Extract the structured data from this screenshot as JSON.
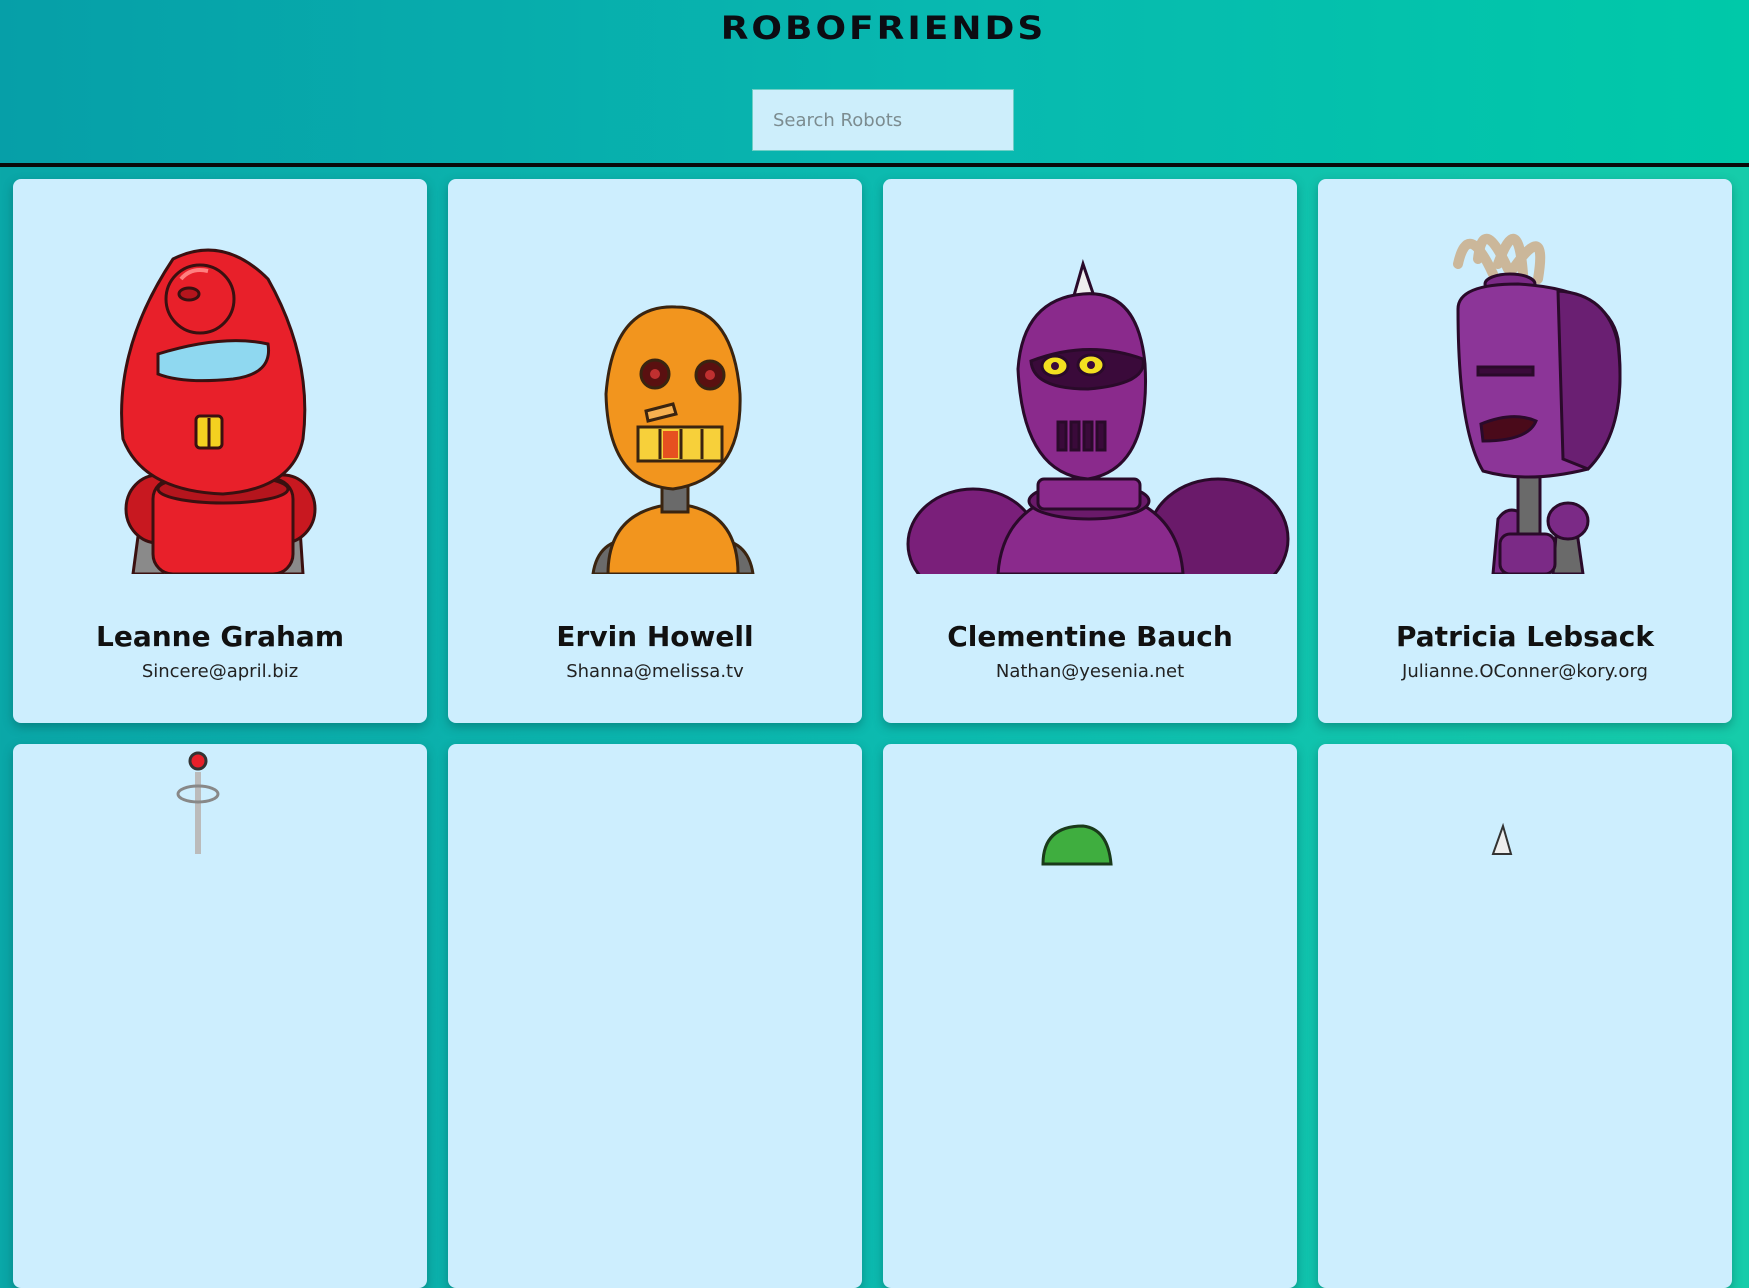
{
  "header": {
    "title": "ROBOFRIENDS",
    "search_placeholder": "Search Robots"
  },
  "robots": [
    {
      "name": "Leanne Graham",
      "email": "Sincere@april.biz",
      "color": "#e8202a"
    },
    {
      "name": "Ervin Howell",
      "email": "Shanna@melissa.tv",
      "color": "#f2951e"
    },
    {
      "name": "Clementine Bauch",
      "email": "Nathan@yesenia.net",
      "color": "#8a2a8c"
    },
    {
      "name": "Patricia Lebsack",
      "email": "Julianne.OConner@kory.org",
      "color": "#7b2a86"
    },
    {
      "name": "",
      "email": "",
      "color": "#cccccc"
    },
    {
      "name": "",
      "email": "",
      "color": "#cccccc"
    },
    {
      "name": "",
      "email": "",
      "color": "#3fae3f"
    },
    {
      "name": "",
      "email": "",
      "color": "#cccccc"
    }
  ],
  "colors": {
    "background_gradient_start": "#069fa8",
    "background_gradient_end": "#00c9a9",
    "card_background": "#cdeefe",
    "title_color": "#0c0c12"
  }
}
